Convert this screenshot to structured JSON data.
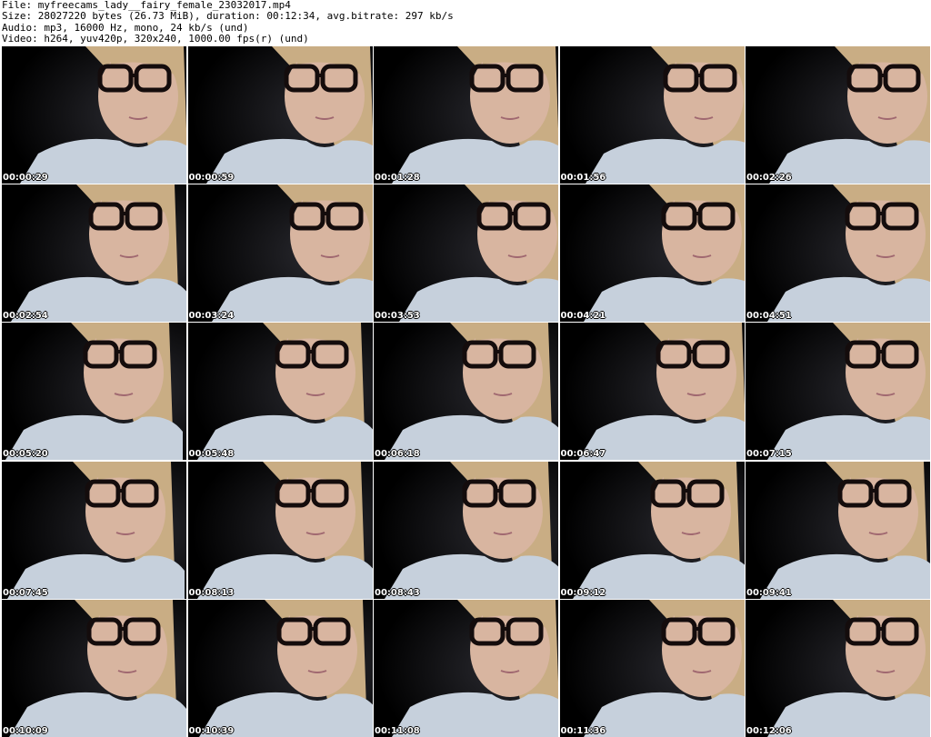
{
  "header": {
    "file_line": "File: myfreecams_lady__fairy_female_23032017.mp4",
    "size_line": "Size: 28027220 bytes (26.73 MiB), duration: 00:12:34, avg.bitrate: 297 kb/s",
    "audio_line": "Audio: mp3, 16000 Hz, mono, 24 kb/s (und)",
    "video_line": "Video: h264, yuv420p, 320x240, 1000.00 fps(r) (und)"
  },
  "thumbnails": [
    {
      "timestamp": "00:00:29"
    },
    {
      "timestamp": "00:00:59"
    },
    {
      "timestamp": "00:01:28"
    },
    {
      "timestamp": "00:01:56"
    },
    {
      "timestamp": "00:02:26"
    },
    {
      "timestamp": "00:02:54"
    },
    {
      "timestamp": "00:03:24"
    },
    {
      "timestamp": "00:03:53"
    },
    {
      "timestamp": "00:04:21"
    },
    {
      "timestamp": "00:04:51"
    },
    {
      "timestamp": "00:05:20"
    },
    {
      "timestamp": "00:05:48"
    },
    {
      "timestamp": "00:06:18"
    },
    {
      "timestamp": "00:06:47"
    },
    {
      "timestamp": "00:07:15"
    },
    {
      "timestamp": "00:07:45"
    },
    {
      "timestamp": "00:08:13"
    },
    {
      "timestamp": "00:08:43"
    },
    {
      "timestamp": "00:09:12"
    },
    {
      "timestamp": "00:09:41"
    },
    {
      "timestamp": "00:10:09"
    },
    {
      "timestamp": "00:10:39"
    },
    {
      "timestamp": "00:11:08"
    },
    {
      "timestamp": "00:11:36"
    },
    {
      "timestamp": "00:12:06"
    }
  ],
  "colors": {
    "background": "#ffffff",
    "frame_background": "#000000",
    "hair": "#c9ad84",
    "skin": "#d8b5a0",
    "shirt": "#c6d0dc",
    "glasses": "#140c0c"
  }
}
